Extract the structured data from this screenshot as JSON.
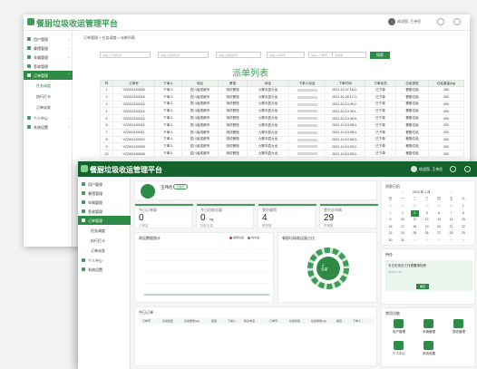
{
  "app": {
    "title": "餐厨垃圾收运管理平台",
    "user": "欢迎您, 王伟伦"
  },
  "colors": {
    "brand": "#2e8b46",
    "brand_dark": "#15622d",
    "accent_light": "#3e9b58"
  },
  "back_window": {
    "breadcrumb": "订单管理 » 任务调度 » 派单列表",
    "sidebar": [
      {
        "label": "用户管理",
        "icon": "user-icon"
      },
      {
        "label": "餐馆管理",
        "icon": "shop-icon"
      },
      {
        "label": "车辆管理",
        "icon": "truck-icon"
      },
      {
        "label": "签收管理",
        "icon": "sign-icon"
      },
      {
        "label": "订单管理",
        "icon": "order-icon",
        "active": true
      },
      {
        "label": "任务调度",
        "sub": true,
        "selected": true
      },
      {
        "label": "执行打卡",
        "sub": true
      },
      {
        "label": "订单派发",
        "sub": true
      },
      {
        "label": "个人中心",
        "icon": "person-icon"
      },
      {
        "label": "系统设置",
        "icon": "settings-icon"
      }
    ],
    "filters": {
      "start_date": "请输入开始时间",
      "end_date": "请输入结束时间",
      "restaurant": "请输入餐馆名称",
      "plate": "请输入车牌号",
      "order_no": "请输入订单号",
      "status": "请选择",
      "search": "搜索"
    },
    "list_title": "派单列表",
    "columns": [
      "",
      "订单号",
      "下单人",
      "地址",
      "餐馆",
      "地址",
      "下单人电话",
      "下单时间",
      "订单状态",
      "垃圾类型",
      "垃圾重量(kg)"
    ],
    "rows": [
      [
        "1",
        "YZ2021120006",
        "下单人",
        "四川省成都市",
        "测试餐馆",
        "九寨沟县九龙",
        "",
        "2021-12-07 16:0..",
        "已下单",
        "餐厨垃圾",
        "150"
      ],
      [
        "2",
        "YZ2021100018",
        "下单人",
        "四川省成都市",
        "测试餐馆",
        "九寨沟县九龙",
        "",
        "2021-10-26 17:3..",
        "已下单",
        "餐厨垃圾",
        "250"
      ],
      [
        "3",
        "YZ2021100015",
        "下单人",
        "四川省成都市",
        "测试餐馆",
        "九寨沟县九龙",
        "",
        "2021-10-14 09:2..",
        "已下单",
        "餐厨垃圾",
        "200"
      ],
      [
        "4",
        "YZ2021100014",
        "下单人",
        "四川省成都市",
        "测试餐馆",
        "九寨沟县九龙",
        "",
        "2021-10-14 09:1..",
        "已下单",
        "餐厨垃圾",
        "200"
      ],
      [
        "5",
        "YZ2021100013",
        "下单人",
        "四川省成都市",
        "测试餐馆",
        "九寨沟县九龙",
        "",
        "2021-10-14 08:5..",
        "已下单",
        "餐厨垃圾",
        "200"
      ],
      [
        "6",
        "YZ2021100012",
        "下单人",
        "四川省成都市",
        "测试餐馆",
        "九寨沟县九龙",
        "",
        "2021-10-14 08:4..",
        "已下单",
        "餐厨垃圾",
        "200"
      ],
      [
        "7",
        "YZ2021100011",
        "下单人",
        "四川省成都市",
        "测试餐馆",
        "九寨沟县九龙",
        "",
        "2021-10-14 08:4..",
        "已下单",
        "餐厨垃圾",
        "200"
      ],
      [
        "8",
        "YZ2021100010",
        "下单人",
        "四川省成都市",
        "测试餐馆",
        "九寨沟县九龙",
        "",
        "2021-10-14 08:3..",
        "已下单",
        "餐厨垃圾",
        "200"
      ],
      [
        "9",
        "YZ2021100009",
        "下单人",
        "四川省成都市",
        "测试餐馆",
        "九寨沟县九龙",
        "",
        "2021-10-14 08:2..",
        "已下单",
        "餐厨垃圾",
        "200"
      ],
      [
        "10",
        "YZ2021100008",
        "下单人",
        "四川省成都市",
        "测试餐馆",
        "九寨沟县九龙",
        "",
        "2021-10-14 08:2..",
        "已下单",
        "餐厨垃圾",
        "200"
      ]
    ]
  },
  "front_window": {
    "sidebar": [
      {
        "label": "用户管理",
        "icon": "user-icon"
      },
      {
        "label": "餐馆管理",
        "icon": "shop-icon"
      },
      {
        "label": "车辆管理",
        "icon": "truck-icon"
      },
      {
        "label": "签收管理",
        "icon": "sign-icon"
      },
      {
        "label": "订单管理",
        "icon": "order-icon",
        "active": true
      },
      {
        "label": "任务调度",
        "sub": true
      },
      {
        "label": "执行打卡",
        "sub": true
      },
      {
        "label": "订单派发",
        "sub": true
      },
      {
        "label": "个人中心",
        "icon": "person-icon"
      },
      {
        "label": "系统设置",
        "icon": "settings-icon"
      }
    ],
    "profile": {
      "name": "王伟伦",
      "badge": "管理员"
    },
    "stats": [
      {
        "label": "今日订单量",
        "value": "0",
        "sub": "订单量"
      },
      {
        "label": "今日回收总量",
        "value": "0",
        "unit": "kg",
        "sub": "回收总量"
      },
      {
        "label": "签约餐馆",
        "value": "4",
        "sub": "餐馆数"
      },
      {
        "label": "签约总车辆",
        "value": "29",
        "sub": "车辆数"
      }
    ],
    "line_chart": {
      "title": "收运数据统计",
      "legend": [
        "餐厨垃圾",
        "地沟油"
      ]
    },
    "donut": {
      "title": "餐厨垃圾收运量占比",
      "center": "总量",
      "center_value": "0"
    },
    "calendar": {
      "title": "消息日历",
      "month": "2022 年 1 月",
      "weekdays": [
        "日",
        "一",
        "二",
        "三",
        "四",
        "五",
        "六"
      ],
      "days": [
        "26",
        "27",
        "28",
        "29",
        "30",
        "31",
        "1",
        "2",
        "3",
        "4",
        "5",
        "6",
        "7",
        "8",
        "9",
        "10",
        "11",
        "12",
        "13",
        "14",
        "15",
        "16",
        "17",
        "18",
        "19",
        "20",
        "21",
        "22",
        "23",
        "24",
        "25",
        "26",
        "27",
        "28",
        "29",
        "30",
        "31",
        "1",
        "2",
        "3",
        "4",
        "5"
      ],
      "today": "4"
    },
    "notice": {
      "title": "待办",
      "text": "今日无待办工作提醒请知悉",
      "date": "2022-01-04",
      "button": "确定"
    },
    "bottom_list": {
      "title": "今日订单",
      "columns": [
        "订单号",
        "垃圾类型",
        "垃圾重量(kg)",
        "餐馆",
        "下单人",
        "联系电话"
      ]
    },
    "quick_actions": {
      "title": "常用功能",
      "items": [
        "用户管理",
        "车辆管理",
        "签收管理",
        "个人中心",
        "系统设置"
      ]
    }
  }
}
